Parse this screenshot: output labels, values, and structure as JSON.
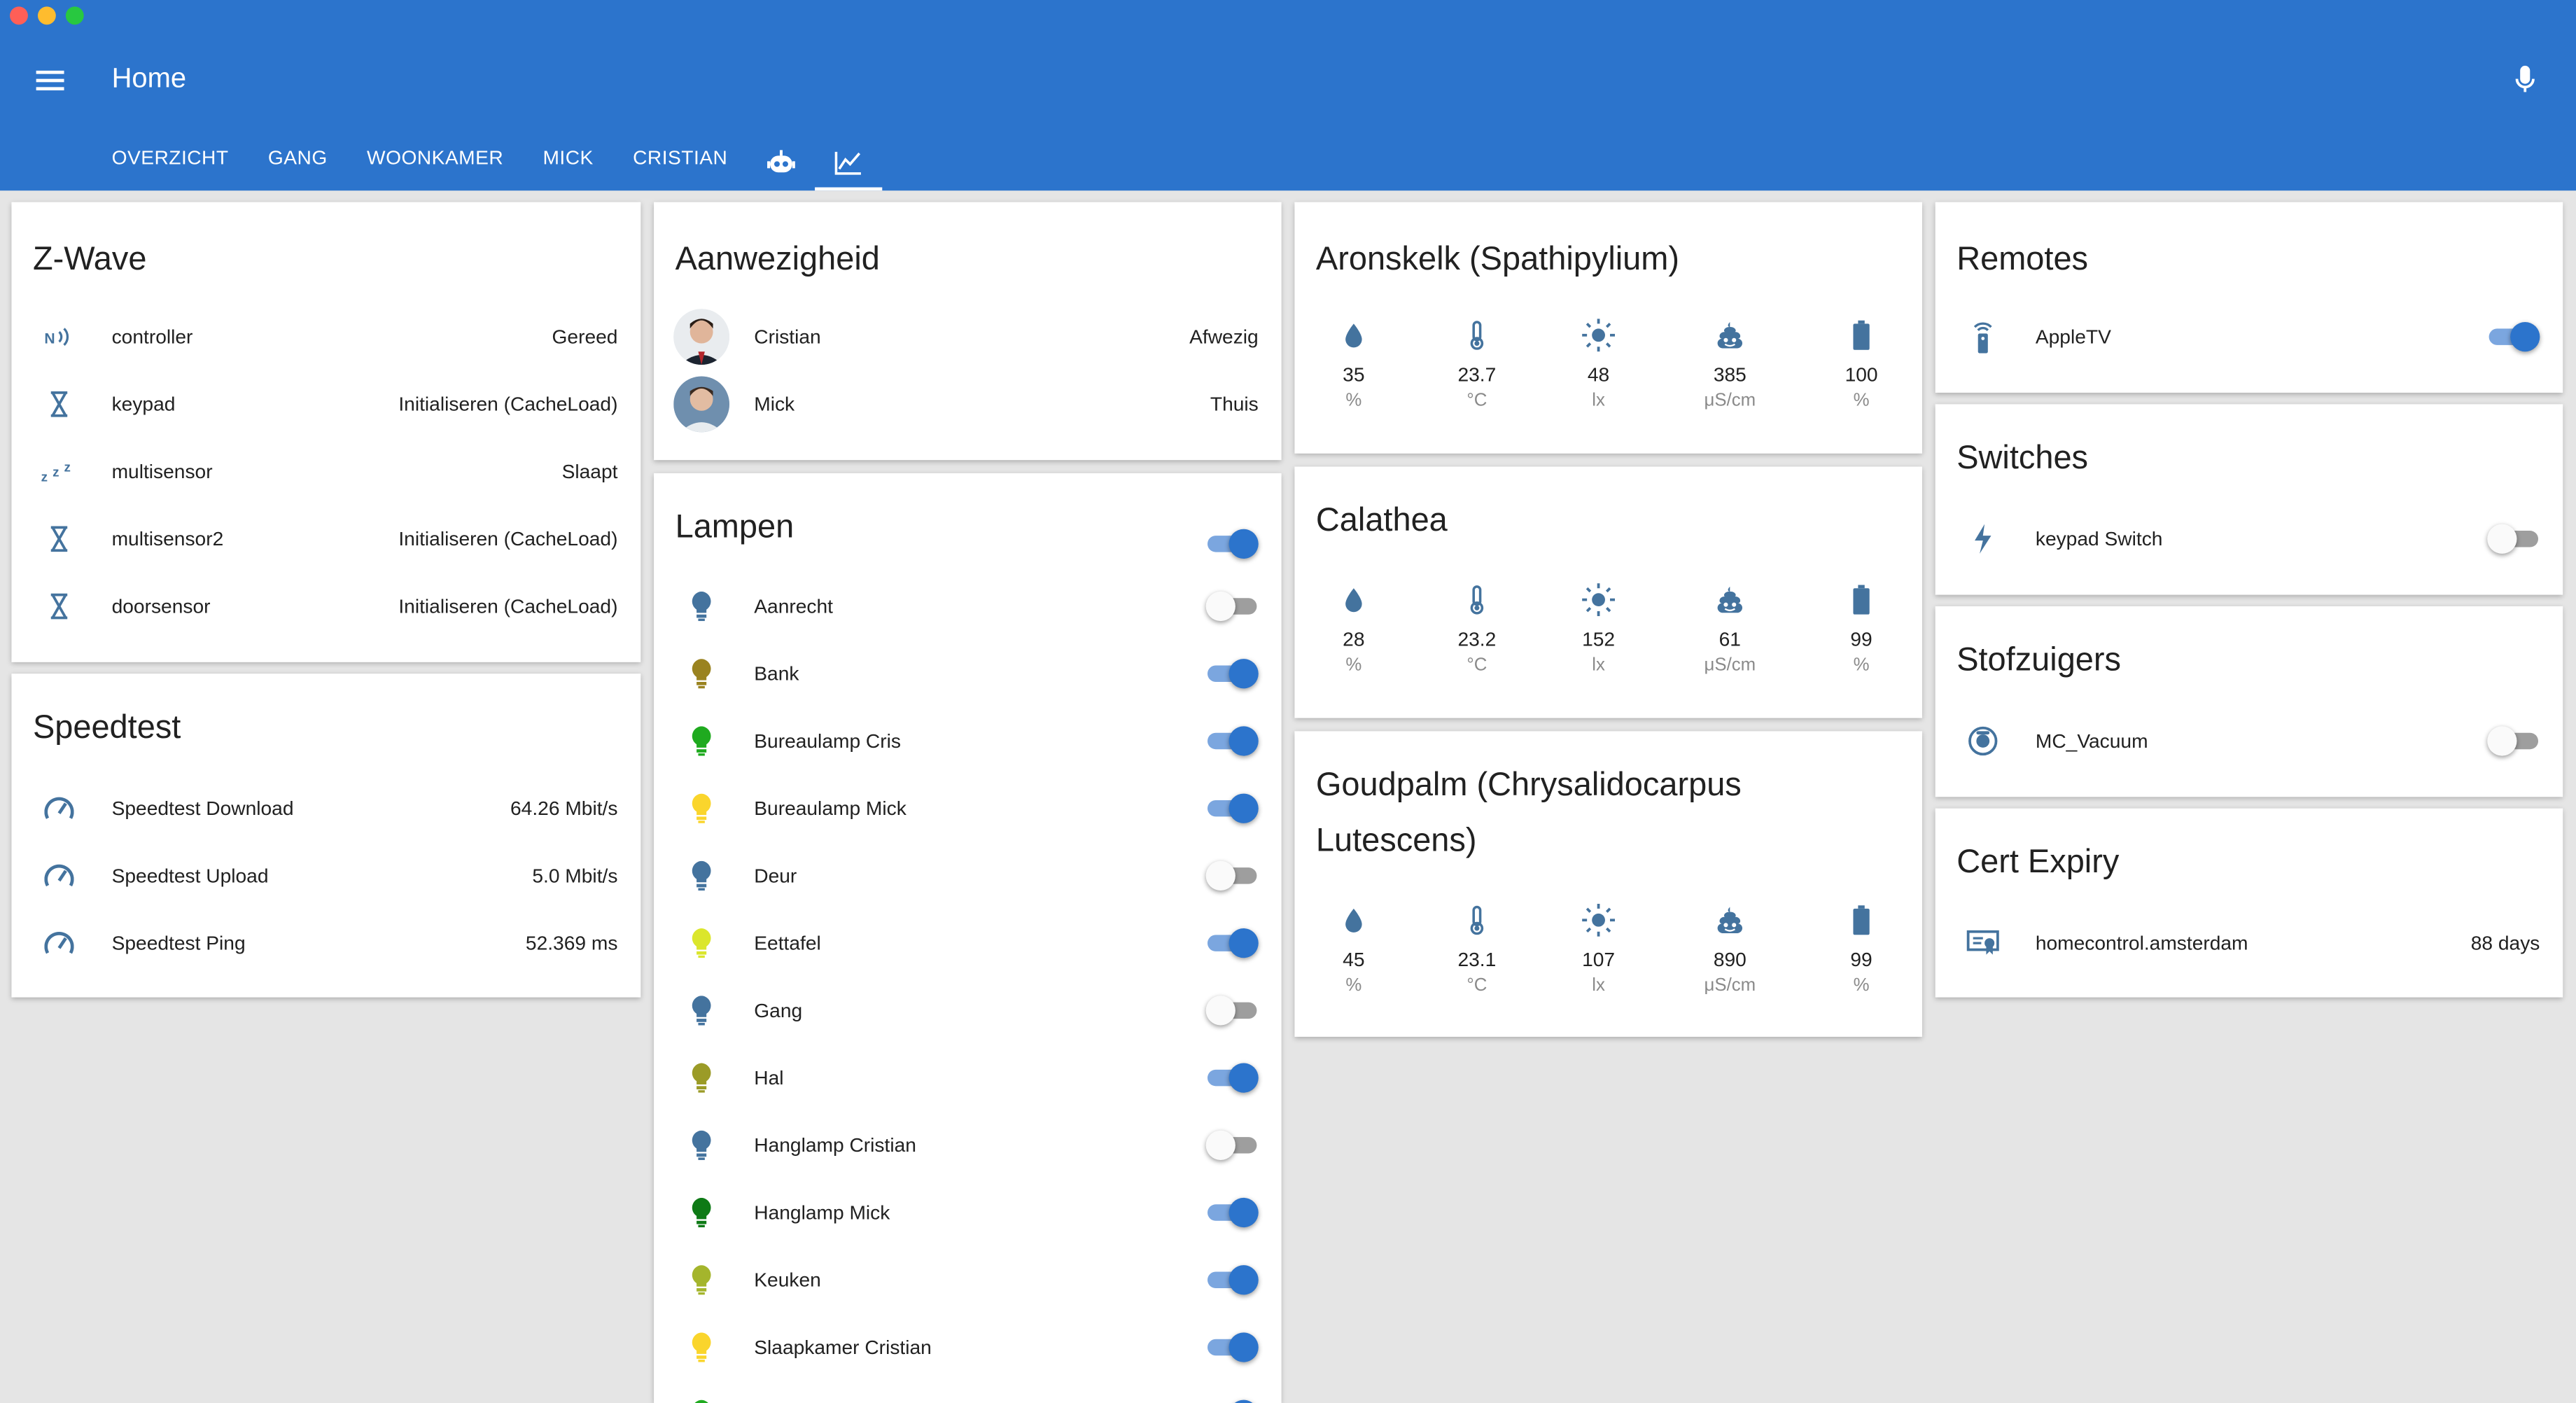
{
  "header": {
    "title": "Home",
    "tabs": [
      "OVERZICHT",
      "GANG",
      "WOONKAMER",
      "MICK",
      "CRISTIAN"
    ],
    "icon_tabs": [
      "robot-icon",
      "chart-line-icon"
    ],
    "active_tab": "chart-line-icon",
    "color": "#2c74cc"
  },
  "zwave": {
    "title": "Z-Wave",
    "rows": [
      {
        "name": "controller",
        "state": "Gereed",
        "icon": "zwave-icon"
      },
      {
        "name": "keypad",
        "state": "Initialiseren (CacheLoad)",
        "icon": "hourglass-icon"
      },
      {
        "name": "multisensor",
        "state": "Slaapt",
        "icon": "sleep-icon"
      },
      {
        "name": "multisensor2",
        "state": "Initialiseren (CacheLoad)",
        "icon": "hourglass-icon"
      },
      {
        "name": "doorsensor",
        "state": "Initialiseren (CacheLoad)",
        "icon": "hourglass-icon"
      }
    ]
  },
  "speedtest": {
    "title": "Speedtest",
    "rows": [
      {
        "name": "Speedtest Download",
        "state": "64.26 Mbit/s"
      },
      {
        "name": "Speedtest Upload",
        "state": "5.0 Mbit/s"
      },
      {
        "name": "Speedtest Ping",
        "state": "52.369 ms"
      }
    ]
  },
  "presence": {
    "title": "Aanwezigheid",
    "rows": [
      {
        "name": "Cristian",
        "state": "Afwezig"
      },
      {
        "name": "Mick",
        "state": "Thuis"
      }
    ]
  },
  "lamps": {
    "title": "Lampen",
    "master_on": true,
    "rows": [
      {
        "name": "Aanrecht",
        "on": false,
        "color": "#44739e"
      },
      {
        "name": "Bank",
        "on": true,
        "color": "#9a8320"
      },
      {
        "name": "Bureaulamp Cris",
        "on": true,
        "color": "#1faa1f"
      },
      {
        "name": "Bureaulamp Mick",
        "on": true,
        "color": "#fad52c"
      },
      {
        "name": "Deur",
        "on": false,
        "color": "#44739e"
      },
      {
        "name": "Eettafel",
        "on": true,
        "color": "#dbe62c"
      },
      {
        "name": "Gang",
        "on": false,
        "color": "#44739e"
      },
      {
        "name": "Hal",
        "on": true,
        "color": "#9b9b27"
      },
      {
        "name": "Hanglamp Cristian",
        "on": false,
        "color": "#44739e"
      },
      {
        "name": "Hanglamp Mick",
        "on": true,
        "color": "#0e7a16"
      },
      {
        "name": "Keuken",
        "on": true,
        "color": "#a4b52c"
      },
      {
        "name": "Slaapkamer Cristian",
        "on": true,
        "color": "#fad52c"
      },
      {
        "name": "",
        "on": true,
        "color": "#1faa1f"
      }
    ]
  },
  "plants": [
    {
      "title": "Aronskelk (Spathipylium)",
      "values": [
        "35",
        "23.7",
        "48",
        "385",
        "100"
      ]
    },
    {
      "title": "Calathea",
      "values": [
        "28",
        "23.2",
        "152",
        "61",
        "99"
      ]
    },
    {
      "title": "Goudpalm (Chrysalidocarpus Lutescens)",
      "values": [
        "45",
        "23.1",
        "107",
        "890",
        "99"
      ]
    }
  ],
  "plant_units": [
    "%",
    "°C",
    "lx",
    "μS/cm",
    "%"
  ],
  "plant_icons": [
    "water-drop-icon",
    "thermometer-icon",
    "sun-icon",
    "poop-icon",
    "battery-icon"
  ],
  "remotes": {
    "title": "Remotes",
    "name": "AppleTV",
    "on": true
  },
  "switches": {
    "title": "Switches",
    "name": "keypad Switch",
    "on": false
  },
  "vacuums": {
    "title": "Stofzuigers",
    "name": "MC_Vacuum",
    "on": false
  },
  "cert": {
    "title": "Cert Expiry",
    "name": "homecontrol.amsterdam",
    "state": "88 days"
  },
  "icon_color": "#44739e"
}
